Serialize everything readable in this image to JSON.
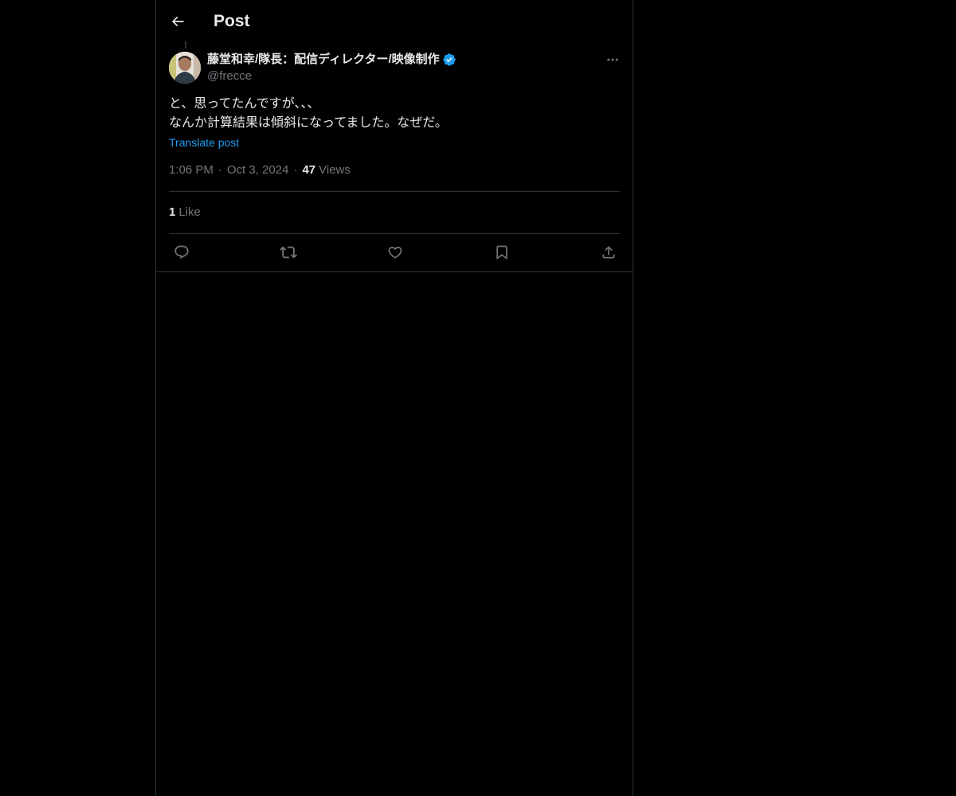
{
  "header": {
    "title": "Post"
  },
  "post": {
    "author": {
      "display_name": "藤堂和幸/隊長：配信ディレクター/映像制作",
      "handle": "@frecce",
      "verified": true
    },
    "text_lines": [
      "と、思ってたんですが、、、",
      "なんか計算結果は傾斜になってました。なぜだ。"
    ],
    "translate_label": "Translate post",
    "time": "1:06 PM",
    "date": "Oct 3, 2024",
    "views_count": "47",
    "views_label": "Views",
    "likes_count": "1",
    "likes_label": "Like"
  },
  "icons": {
    "back": "arrow-left-icon",
    "more": "more-horizontal-icon",
    "reply": "reply-icon",
    "repost": "repost-icon",
    "like": "heart-icon",
    "bookmark": "bookmark-icon",
    "share": "share-icon",
    "verified": "verified-badge-icon"
  },
  "colors": {
    "background": "#000000",
    "text": "#e7e9ea",
    "secondary_text": "#71767b",
    "accent": "#1d9bf0",
    "border": "#2f3336"
  }
}
